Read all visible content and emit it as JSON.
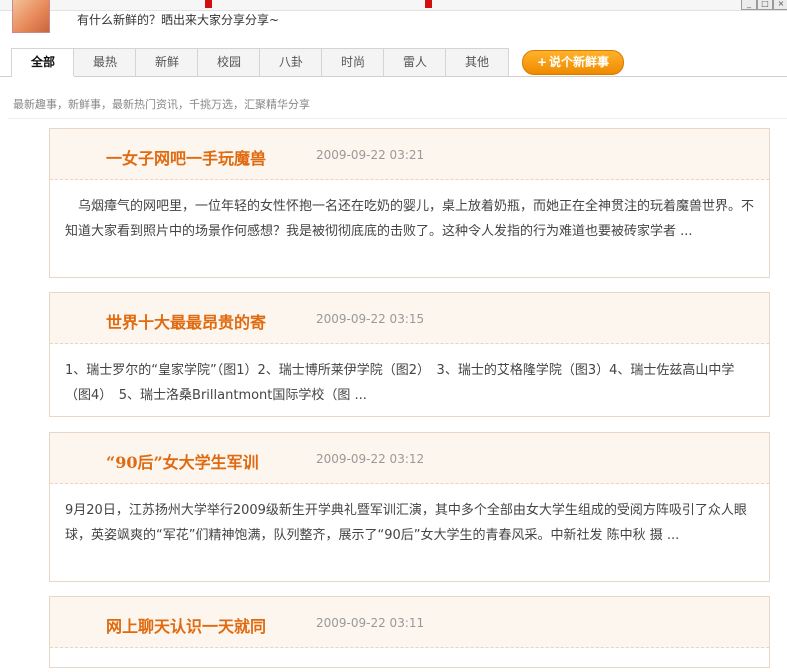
{
  "header": {
    "tagline": "有什么新鲜的？晒出来大家分享分享~"
  },
  "tabs": [
    {
      "label": "全部",
      "active": true
    },
    {
      "label": "最热",
      "active": false
    },
    {
      "label": "新鲜",
      "active": false
    },
    {
      "label": "校园",
      "active": false
    },
    {
      "label": "八卦",
      "active": false
    },
    {
      "label": "时尚",
      "active": false
    },
    {
      "label": "雷人",
      "active": false
    },
    {
      "label": "其他",
      "active": false
    }
  ],
  "post_button": {
    "label": "说个新鲜事",
    "icon": "plus-icon"
  },
  "subtitle": "最新趣事，新鲜事，最新热门资讯，千挑万选，汇聚精华分享",
  "posts": [
    {
      "title": "一女子网吧一手玩魔兽",
      "date": "2009-09-22 03:21",
      "excerpt": "　乌烟瘴气的网吧里，一位年轻的女性怀抱一名还在吃奶的婴儿，桌上放着奶瓶，而她正在全神贯注的玩着魔兽世界。不知道大家看到照片中的场景作何感想？我是被彻彻底底的击败了。这种令人发指的行为难道也要被砖家学者 ..."
    },
    {
      "title": "世界十大最最昂贵的寄",
      "date": "2009-09-22 03:15",
      "excerpt": "1、瑞士罗尔的“皇家学院”（图1）2、瑞士博所莱伊学院（图2）　3、瑞士的艾格隆学院（图3）4、瑞士佐兹高山中学（图4）　5、瑞士洛桑Brillantmont国际学校（图 ..."
    },
    {
      "title": "“90后”女大学生军训",
      "date": "2009-09-22 03:12",
      "excerpt": "9月20日，江苏扬州大学举行2009级新生开学典礼暨军训汇演，其中多个全部由女大学生组成的受阅方阵吸引了众人眼球，英姿飒爽的“军花”们精神饱满，队列整齐，展示了“90后”女大学生的青春风采。中新社发 陈中秋 摄 ..."
    },
    {
      "title": "网上聊天认识一天就同",
      "date": "2009-09-22 03:11",
      "excerpt": ""
    }
  ]
}
